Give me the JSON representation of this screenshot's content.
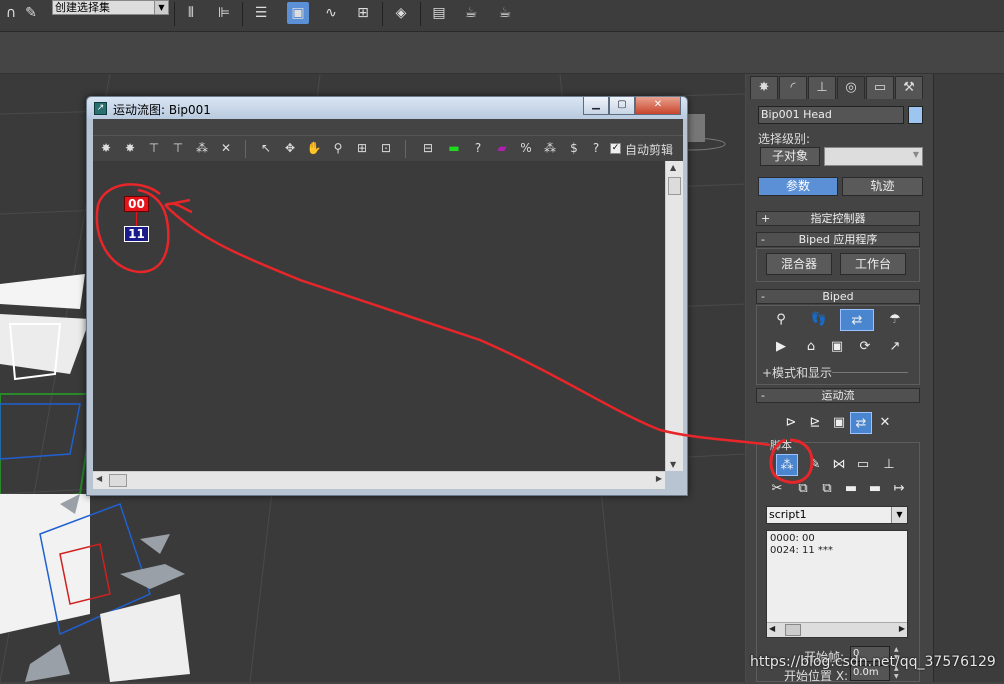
{
  "toolbar": {
    "selection_set": "创建选择集",
    "icons": [
      "magnet-icon",
      "spell-check-icon",
      "mirror-icon",
      "align-icon",
      "layer-icon",
      "scene-explorer-icon",
      "curve-editor-icon",
      "schematic-icon",
      "material-editor-icon",
      "render-setup-icon",
      "rendered-frame-icon",
      "render-icon"
    ]
  },
  "command_panel": {
    "tabs": [
      "create",
      "modify",
      "hierarchy",
      "motion",
      "display",
      "utilities"
    ],
    "object_name": "Bip001 Head",
    "select_level_label": "选择级别:",
    "sub_object_button": "子对象",
    "params_button": "参数",
    "trajectory_button": "轨迹",
    "rollout_assign_controller": "指定控制器",
    "rollout_biped_apps": "Biped 应用程序",
    "mixer_button": "混合器",
    "workbench_button": "工作台",
    "rollout_biped": "Biped",
    "modes_display": "+模式和显示",
    "rollout_motion_flow": "运动流",
    "script_group_label": "脚本",
    "script_select": "script1",
    "script_lines": [
      "0000: 00",
      "0024: 11 ***"
    ],
    "start_frame_label": "开始帧:",
    "start_frame_value": "0",
    "start_pos_label": "开始位置 X:",
    "start_pos_value": "0.0m"
  },
  "motion_flow_window": {
    "title": "运动流图: Bip001",
    "auto_clip_label": "自动剪辑",
    "auto_clip_checked": true,
    "nodes": [
      {
        "label": "00",
        "color": "#e8141b"
      },
      {
        "label": "11",
        "color": "#1a1a8a"
      }
    ]
  },
  "watermark": "https://blog.csdn.net/qq_37576129",
  "colors": {
    "accent": "#5b8fd6",
    "annotation": "#e8262a"
  }
}
